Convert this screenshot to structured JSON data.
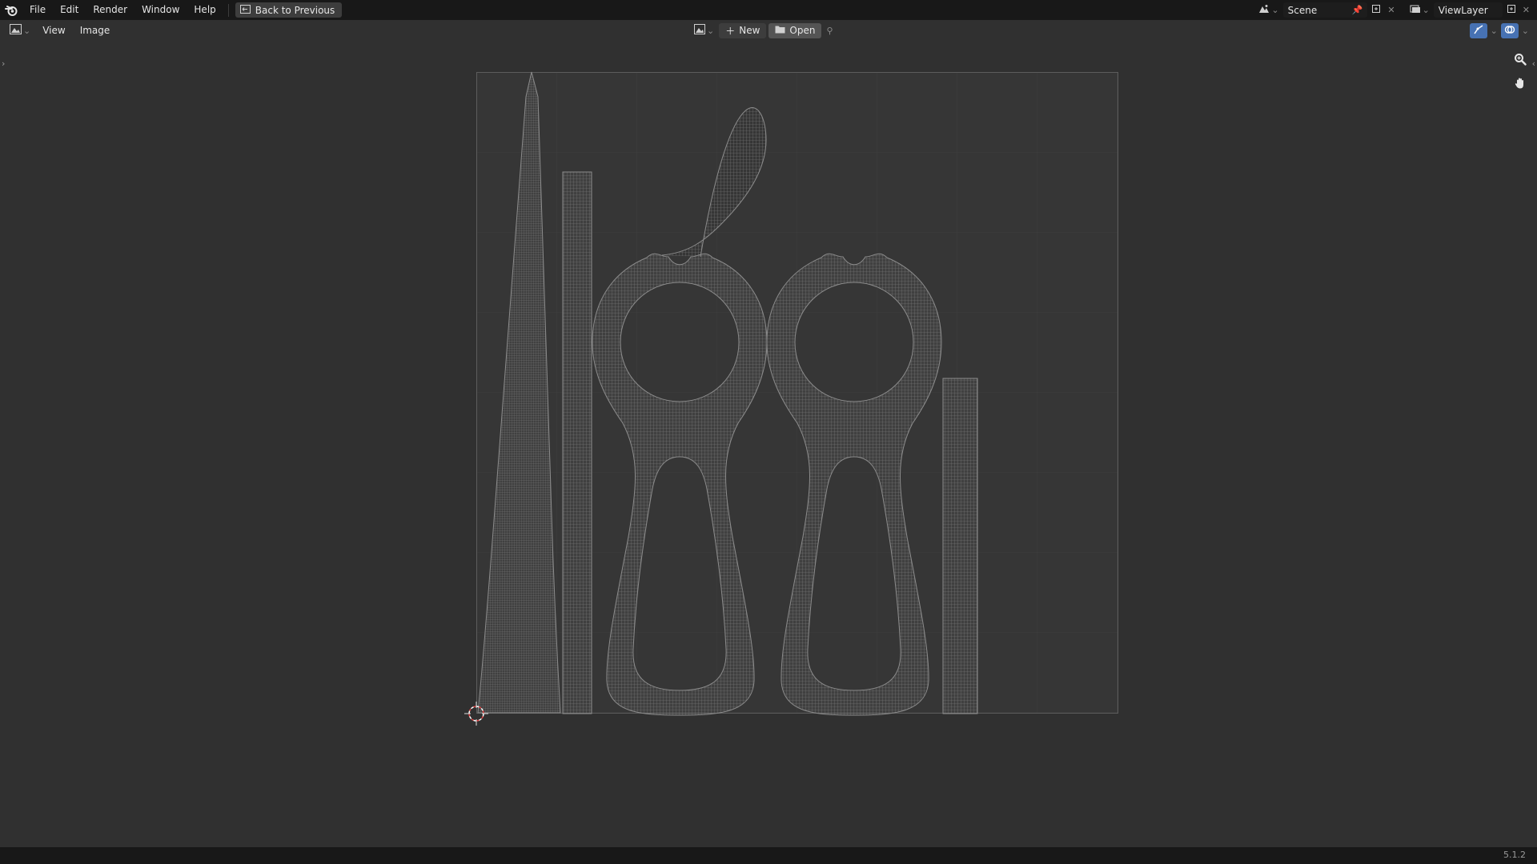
{
  "menubar": {
    "items": [
      "File",
      "Edit",
      "Render",
      "Window",
      "Help"
    ],
    "back_label": "Back to Previous",
    "scene_name": "Scene",
    "view_layer": "ViewLayer"
  },
  "header": {
    "menus": [
      "View",
      "Image"
    ],
    "new_label": "New",
    "open_label": "Open"
  },
  "colors": {
    "accent_blue": "#4772b3",
    "background": "#303030",
    "bar": "#181818",
    "uv_wire": "#8c8c8c",
    "cursor_red": "#e04040"
  },
  "status": {
    "version": "5.1.2"
  }
}
